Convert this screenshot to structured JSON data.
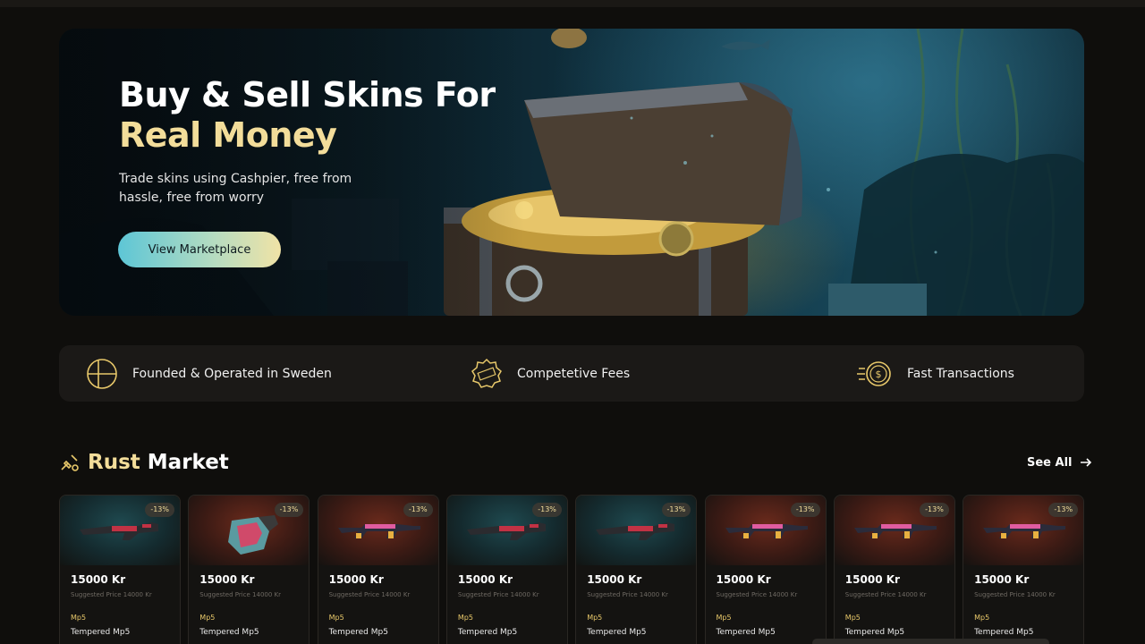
{
  "hero": {
    "title_line1": "Buy & Sell Skins For",
    "title_line2": "Real Money",
    "subtitle": "Trade skins using Cashpier, free from hassle, free from worry",
    "cta_label": "View Marketplace"
  },
  "features": [
    {
      "icon": "sweden-flag-icon",
      "label": "Founded & Operated in Sweden"
    },
    {
      "icon": "fees-badge-icon",
      "label": "Competetive Fees"
    },
    {
      "icon": "coin-speed-icon",
      "label": "Fast Transactions"
    }
  ],
  "section": {
    "title_highlight": "Rust",
    "title_rest": "Market",
    "see_all_label": "See All"
  },
  "cards": [
    {
      "badge": "-13%",
      "price": "15000 Kr",
      "suggested": "Suggested Price 14000 Kr",
      "type": "Mp5",
      "name": "Tempered Mp5",
      "theme": "teal",
      "item": "smg-icon"
    },
    {
      "badge": "-13%",
      "price": "15000 Kr",
      "suggested": "Suggested Price 14000 Kr",
      "type": "Mp5",
      "name": "Tempered Mp5",
      "theme": "red",
      "item": "gloves-icon"
    },
    {
      "badge": "-13%",
      "price": "15000 Kr",
      "suggested": "Suggested Price 14000 Kr",
      "type": "Mp5",
      "name": "Tempered Mp5",
      "theme": "red",
      "item": "rifle-icon"
    },
    {
      "badge": "-13%",
      "price": "15000 Kr",
      "suggested": "Suggested Price 14000 Kr",
      "type": "Mp5",
      "name": "Tempered Mp5",
      "theme": "teal",
      "item": "smg-icon"
    },
    {
      "badge": "-13%",
      "price": "15000 Kr",
      "suggested": "Suggested Price 14000 Kr",
      "type": "Mp5",
      "name": "Tempered Mp5",
      "theme": "teal",
      "item": "smg-icon"
    },
    {
      "badge": "-13%",
      "price": "15000 Kr",
      "suggested": "Suggested Price 14000 Kr",
      "type": "Mp5",
      "name": "Tempered Mp5",
      "theme": "red",
      "item": "rifle-icon"
    },
    {
      "badge": "-13%",
      "price": "15000 Kr",
      "suggested": "Suggested Price 14000 Kr",
      "type": "Mp5",
      "name": "Tempered Mp5",
      "theme": "red",
      "item": "rifle-icon"
    },
    {
      "badge": "-13%",
      "price": "15000 Kr",
      "suggested": "Suggested Price 14000 Kr",
      "type": "Mp5",
      "name": "Tempered Mp5",
      "theme": "red",
      "item": "rifle-icon"
    }
  ],
  "colors": {
    "accent_gold": "#f3dd9a",
    "cta_gradient_start": "#5dc6d6",
    "cta_gradient_end": "#f0e3a6",
    "background": "#0f0e0c"
  }
}
